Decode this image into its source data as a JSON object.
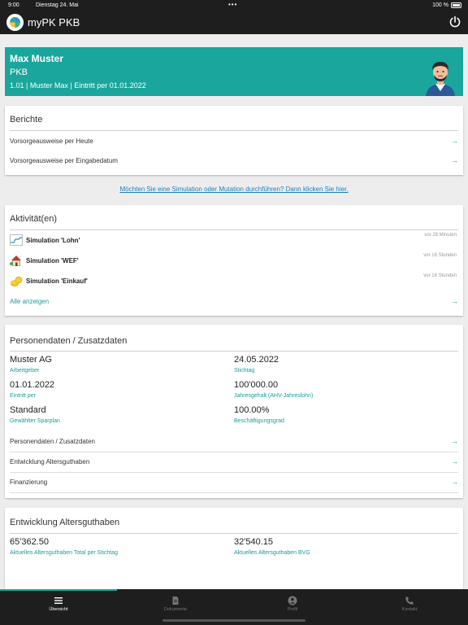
{
  "status": {
    "time": "9:00",
    "date": "Dienstag 24. Mai",
    "battery": "100 %"
  },
  "app": {
    "title": "myPK PKB"
  },
  "profile": {
    "name": "Max Muster",
    "org": "PKB",
    "info": "1.01 | Muster Max | Eintritt per 01.01.2022"
  },
  "berichte": {
    "title": "Berichte",
    "items": [
      "Vorsorgeausweise per Heute",
      "Vorsorgeausweise per Eingabedatum"
    ]
  },
  "sim_link": "Möchten Sie eine Simulation oder Mutation durchführen? Dann klicken Sie hier.",
  "aktivitaeten": {
    "title": "Aktivität(en)",
    "items": [
      {
        "label": "Simulation 'Lohn'",
        "time": "vor 28 Minuten",
        "icon": "salary-chart-icon"
      },
      {
        "label": "Simulation 'WEF'",
        "time": "vor 16 Stunden",
        "icon": "house-icon"
      },
      {
        "label": "Simulation 'Einkauf'",
        "time": "vor 16 Stunden",
        "icon": "coins-icon"
      }
    ],
    "show_all": "Alle anzeigen"
  },
  "personendaten": {
    "title": "Personendaten / Zusatzdaten",
    "fields": [
      {
        "value": "Muster AG",
        "label": "Arbeitgeber"
      },
      {
        "value": "24.05.2022",
        "label": "Stichtag"
      },
      {
        "value": "01.01.2022",
        "label": "Eintritt per"
      },
      {
        "value": "100'000.00",
        "label": "Jahresgehalt (AHV-Jahreslohn)"
      },
      {
        "value": "Standard",
        "label": "Gewählter Sparplan"
      },
      {
        "value": "100.00%",
        "label": "Beschäftigungsgrad"
      }
    ],
    "links": [
      "Personendaten / Zusatzdaten",
      "Entwicklung Altersguthaben",
      "Finanzierung"
    ]
  },
  "altersguthaben": {
    "title": "Entwicklung Altersguthaben",
    "fields": [
      {
        "value": "65'362.50",
        "label": "Aktuelles Altersguthaben Total per Stichtag"
      },
      {
        "value": "32'540.15",
        "label": "Aktuelles Altersguthaben BVG"
      }
    ]
  },
  "tabs": [
    "Übersicht",
    "Dokumente",
    "Profil",
    "Kontakt"
  ],
  "colors": {
    "accent": "#1aa69c",
    "dark": "#1e1e1e",
    "link": "#1a7fc0"
  }
}
